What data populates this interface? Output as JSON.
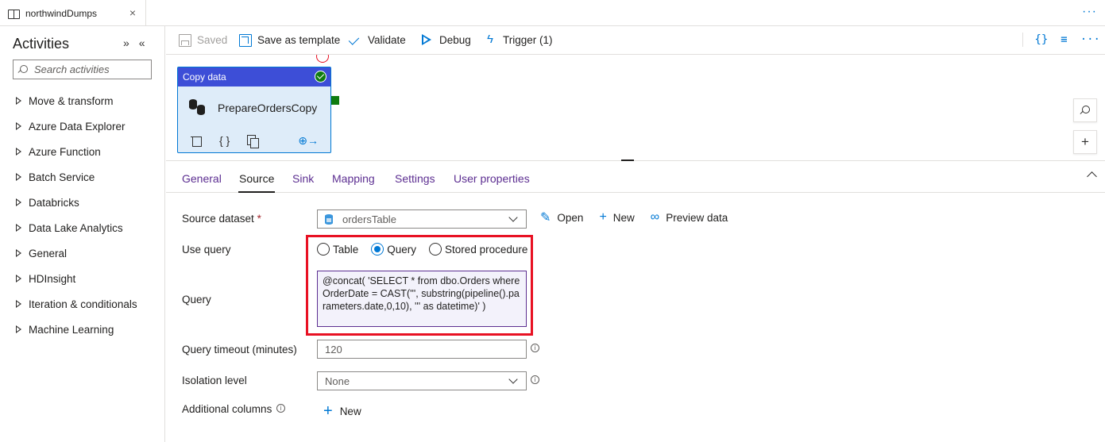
{
  "tab": {
    "title": "northwindDumps",
    "close": "×"
  },
  "tabstrip": {
    "more": "···"
  },
  "sidebar": {
    "title": "Activities",
    "search_placeholder": "Search activities",
    "items": [
      "Move & transform",
      "Azure Data Explorer",
      "Azure Function",
      "Batch Service",
      "Databricks",
      "Data Lake Analytics",
      "General",
      "HDInsight",
      "Iteration & conditionals",
      "Machine Learning"
    ]
  },
  "toolbar": {
    "saved": "Saved",
    "save_template": "Save as template",
    "validate": "Validate",
    "debug": "Debug",
    "trigger": "Trigger (1)",
    "code_icon": "{}",
    "settings_icon": "≡",
    "more": "···"
  },
  "activity": {
    "type": "Copy data",
    "name": "PrepareOrdersCopy",
    "code": "{ }"
  },
  "ptabs": [
    "General",
    "Source",
    "Sink",
    "Mapping",
    "Settings",
    "User properties"
  ],
  "ptabs_active": "Source",
  "form": {
    "source_dataset_label": "Source dataset",
    "required_mark": "*",
    "source_dataset_value": "ordersTable",
    "open": "Open",
    "new": "New",
    "preview": "Preview data",
    "use_query_label": "Use query",
    "radio_table": "Table",
    "radio_query": "Query",
    "radio_sp": "Stored procedure",
    "radio_selected": "Query",
    "query_label": "Query",
    "query_value": "@concat( 'SELECT * from dbo.Orders where OrderDate = CAST(''', substring(pipeline().parameters.date,0,10), ''' as datetime)' )",
    "timeout_label": "Query timeout (minutes)",
    "timeout_value": "120",
    "isolation_label": "Isolation level",
    "isolation_value": "None",
    "additional_label": "Additional columns",
    "additional_new": "New",
    "info": "i"
  },
  "colors": {
    "accent": "#0078d4",
    "activity_header": "#3d4ed7",
    "highlight": "#e81123",
    "success": "#107c10"
  }
}
